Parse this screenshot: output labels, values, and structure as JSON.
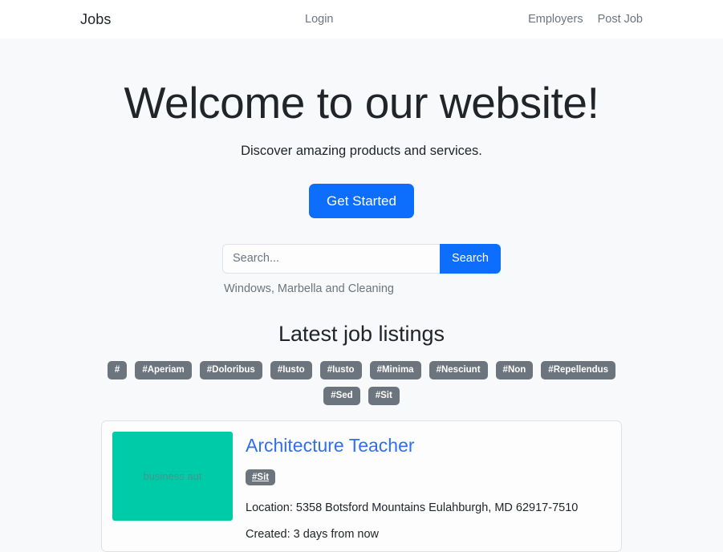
{
  "navbar": {
    "brand": "Jobs",
    "center_links": [
      {
        "label": "Login",
        "name": "nav-link-login"
      }
    ],
    "right_links": [
      {
        "label": "Employers",
        "name": "nav-link-employers"
      },
      {
        "label": "Post Job",
        "name": "nav-link-post-job"
      }
    ]
  },
  "hero": {
    "title": "Welcome to our website!",
    "subtitle": "Discover amazing products and services.",
    "cta_label": "Get Started"
  },
  "search": {
    "value": "",
    "placeholder": "Search...",
    "button_label": "Search",
    "note": "Windows, Marbella and Cleaning"
  },
  "listings": {
    "section_title": "Latest job listings",
    "tags": [
      "#",
      "#Aperiam",
      "#Doloribus",
      "#Iusto",
      "#Iusto",
      "#Minima",
      "#Nesciunt",
      "#Non",
      "#Repellendus",
      "#Sed",
      "#Sit"
    ],
    "jobs": [
      {
        "thumb_text": "business aut",
        "title": "Architecture Teacher",
        "tag": "#Sit",
        "location": "Location: 5358 Botsford Mountains Eulahburgh, MD 62917-7510",
        "created": "Created: 3 days from now"
      }
    ]
  },
  "colors": {
    "primary": "#0d6efd",
    "badge": "#6c757d",
    "link": "#2f6ef5",
    "thumb": "#00cba9",
    "page_bg": "#f8f9fa",
    "navbar_bg": "#ffffff"
  }
}
